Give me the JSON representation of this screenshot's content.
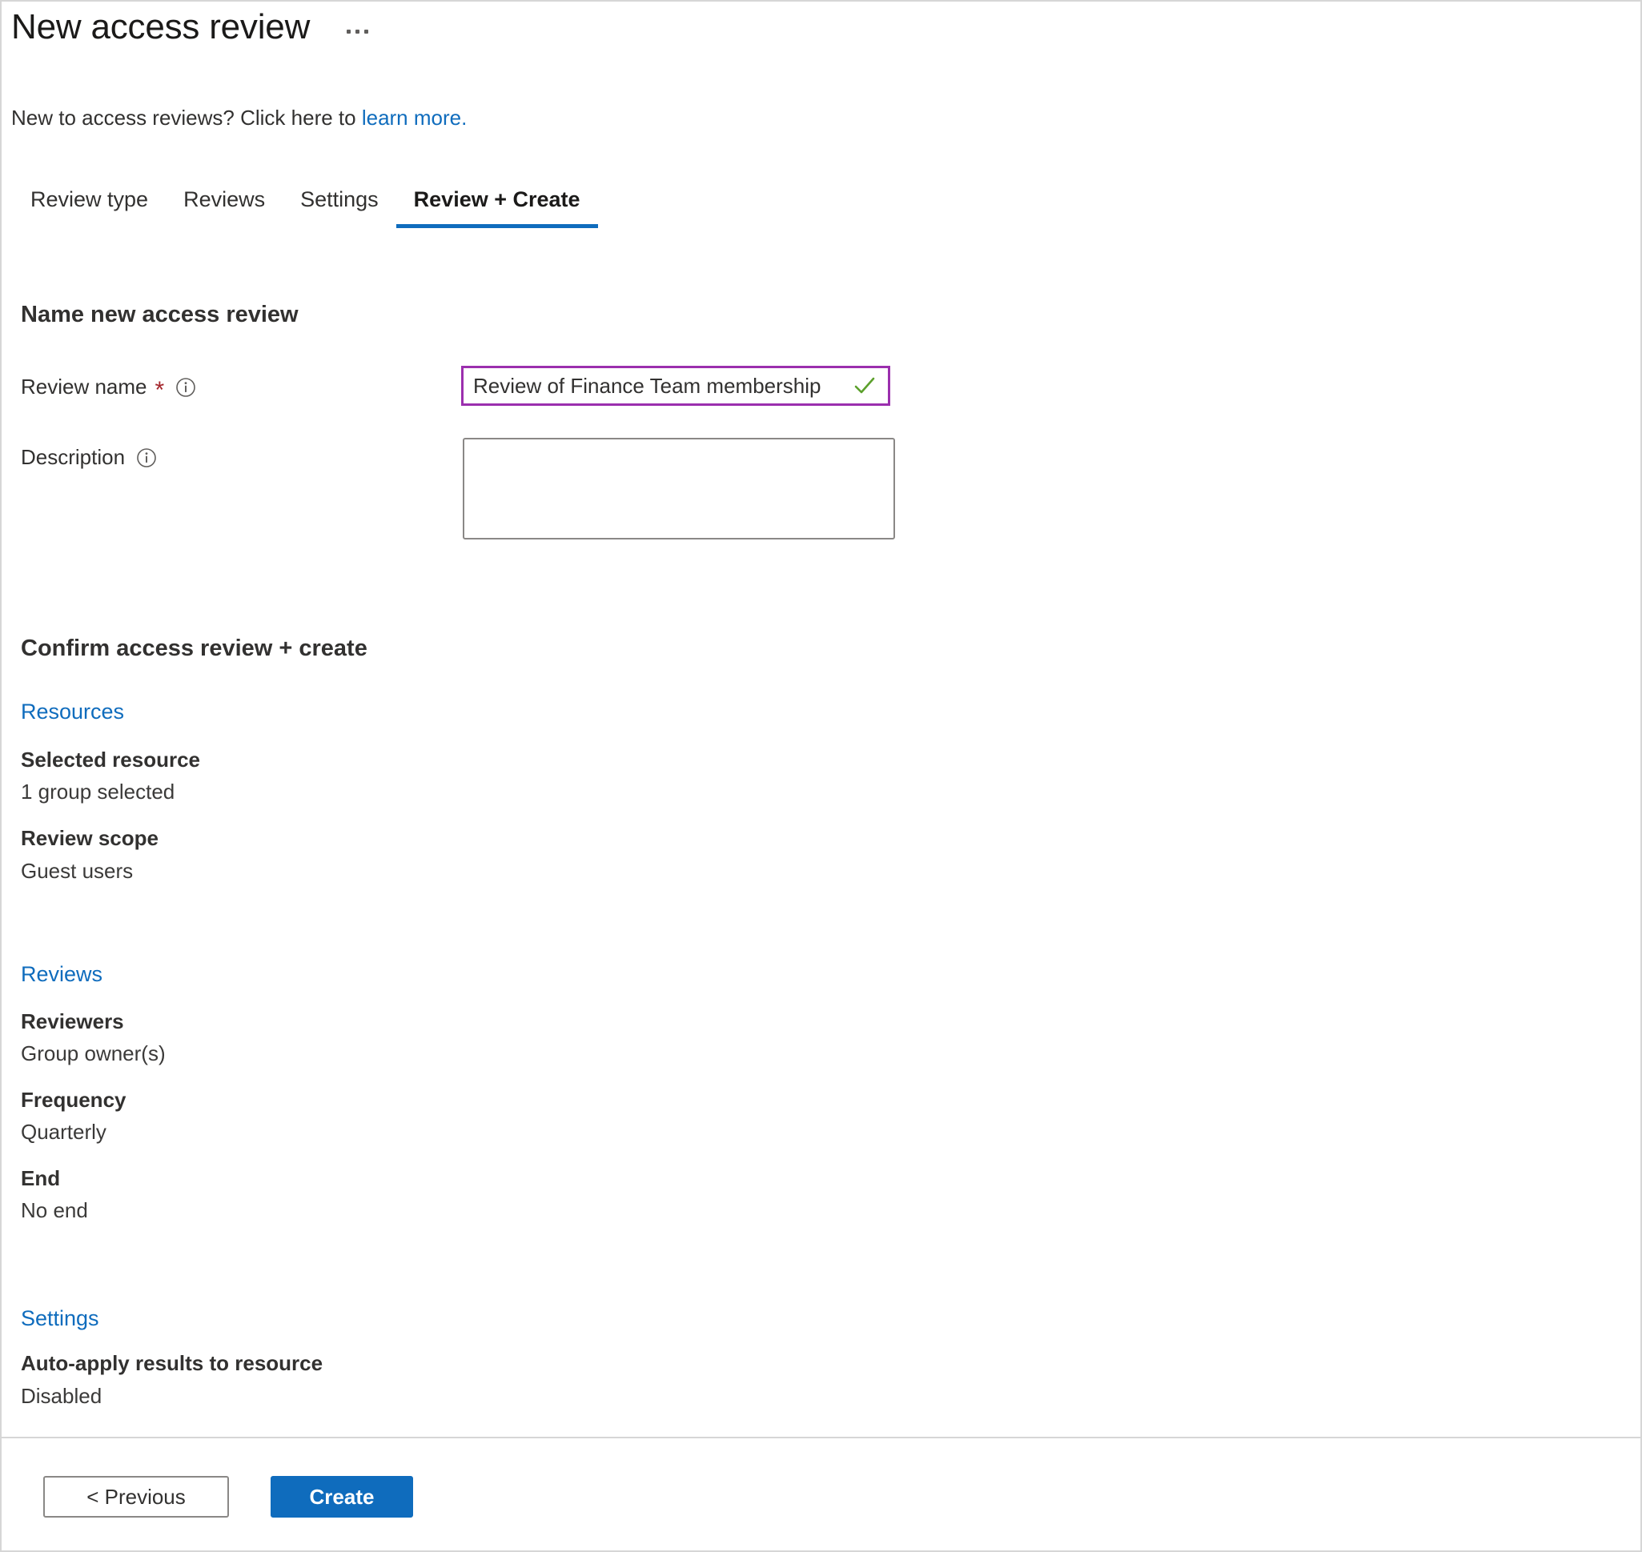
{
  "header": {
    "title": "New access review",
    "more_menu": "more-options"
  },
  "subheader": {
    "text_before": "New to access reviews? Click here to ",
    "link_text": "learn more."
  },
  "tabs": [
    {
      "label": "Review type",
      "active": false
    },
    {
      "label": "Reviews",
      "active": false
    },
    {
      "label": "Settings",
      "active": false
    },
    {
      "label": "Review + Create",
      "active": true
    }
  ],
  "name_section": {
    "heading": "Name new access review",
    "review_name": {
      "label": "Review name",
      "required_marker": "*",
      "value": "Review of Finance Team membership",
      "placeholder": "",
      "valid": true
    },
    "description": {
      "label": "Description",
      "value": "",
      "placeholder": ""
    }
  },
  "confirm_section": {
    "heading": "Confirm access review + create",
    "groups": [
      {
        "link": "Resources",
        "rows": [
          {
            "key": "Selected resource",
            "value": "1 group selected"
          },
          {
            "key": "Review scope",
            "value": "Guest users"
          }
        ]
      },
      {
        "link": "Reviews",
        "rows": [
          {
            "key": "Reviewers",
            "value": "Group owner(s)"
          },
          {
            "key": "Frequency",
            "value": "Quarterly"
          },
          {
            "key": "End",
            "value": "No end"
          }
        ]
      },
      {
        "link": "Settings",
        "rows": [
          {
            "key": "Auto-apply results to resource",
            "value": "Disabled"
          }
        ]
      }
    ]
  },
  "footer": {
    "previous_label": "< Previous",
    "create_label": "Create"
  },
  "colors": {
    "accent_blue": "#0f6cbd",
    "link_blue": "#0f6cbd",
    "required_red": "#a4262c",
    "input_focus_purple": "#9b2fae",
    "valid_green": "#5ca02c",
    "border_gray": "#8a8886",
    "text_primary": "#323130"
  }
}
